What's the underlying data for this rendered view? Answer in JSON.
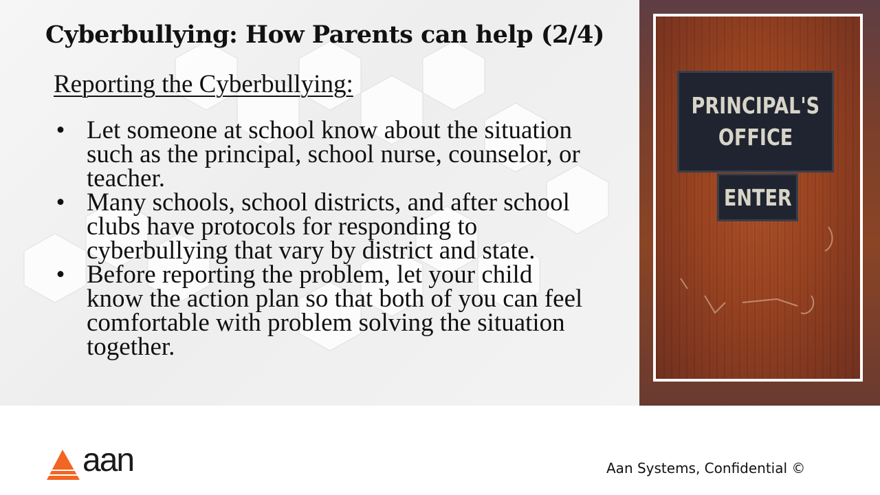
{
  "slide": {
    "title": "Cyberbullying: How Parents can help (2/4)",
    "subheading": "Reporting the Cyberbullying:",
    "bullet_symbol": "•",
    "bullets": [
      "Let someone at school know about the situation such as the principal, school nurse, counselor, or teacher.",
      "Many schools, school districts, and after school clubs have protocols for responding to cyberbullying that vary by district and state.",
      "Before reporting the problem, let your child know the action plan so that both of you can feel comfortable with problem solving the situation together."
    ]
  },
  "photo": {
    "sign_line_1": "PRINCIPAL'S",
    "sign_line_2": "OFFICE",
    "sign_small": "ENTER"
  },
  "logo": {
    "text": "aan",
    "accent_color": "#f26522"
  },
  "footer": {
    "text": "Aan Systems, Confidential ©"
  }
}
